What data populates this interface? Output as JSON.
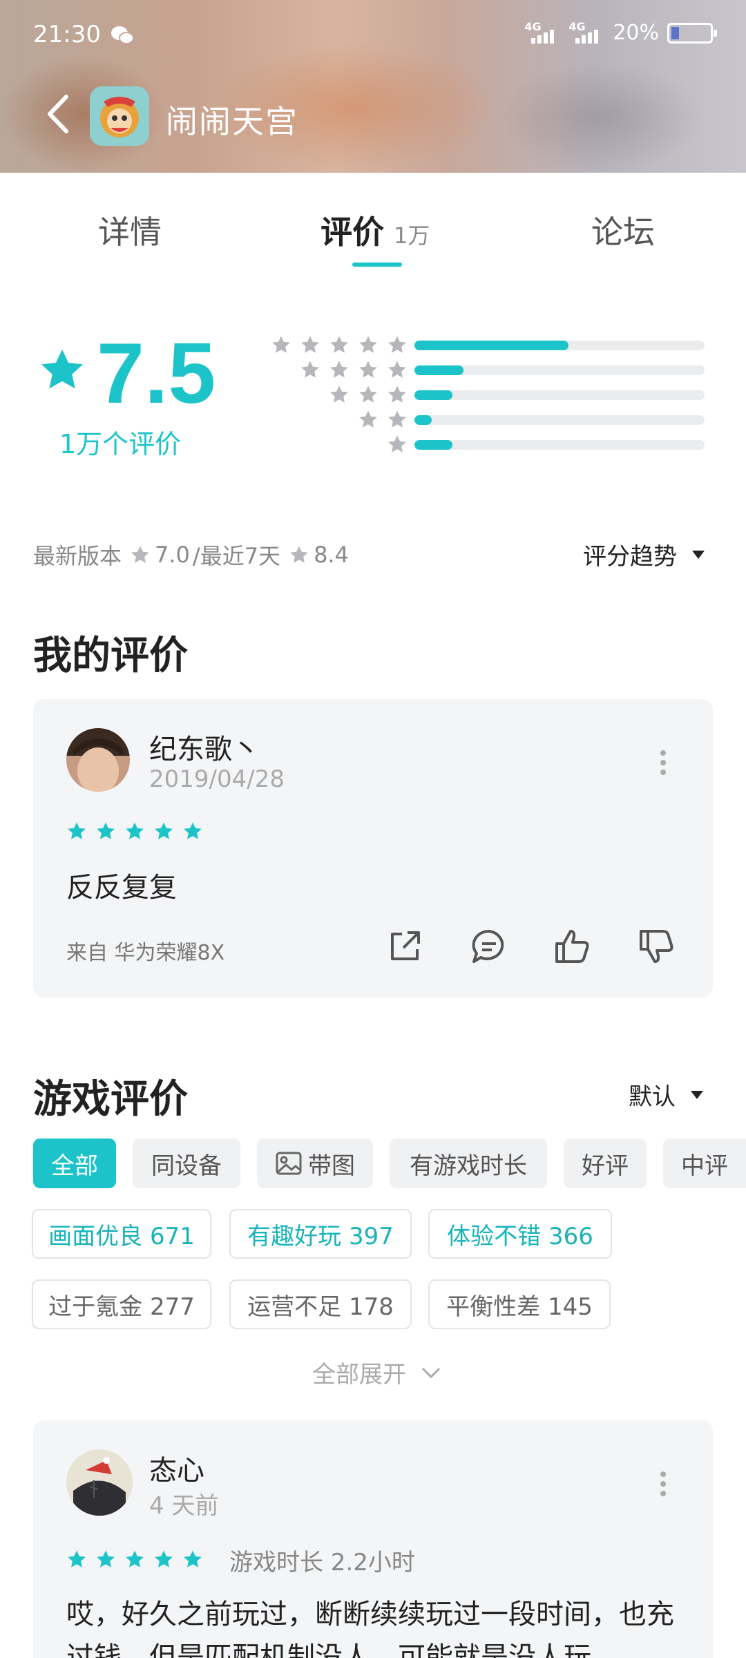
{
  "status_bar": {
    "time": "21:30",
    "signal1": "4G",
    "signal2": "4G",
    "battery": "20%",
    "battery_level": 0.2
  },
  "header": {
    "title": "闹闹天宫"
  },
  "tabs": [
    {
      "label": "详情"
    },
    {
      "label": "评价",
      "count": "1万"
    },
    {
      "label": "论坛"
    }
  ],
  "rating": {
    "score": "7.5",
    "count_label": "1万个评价",
    "distribution": [
      {
        "stars": 5,
        "fraction": 0.53
      },
      {
        "stars": 4,
        "fraction": 0.17
      },
      {
        "stars": 3,
        "fraction": 0.13
      },
      {
        "stars": 2,
        "fraction": 0.06
      },
      {
        "stars": 1,
        "fraction": 0.13
      }
    ]
  },
  "version": {
    "latest_label": "最新版本",
    "latest_score": "7.0",
    "recent_label": "/最近7天",
    "recent_score": "8.4",
    "trend_label": "评分趋势"
  },
  "my_review": {
    "section_title": "我的评价",
    "user": "纪东歌丶",
    "date": "2019/04/28",
    "stars": 5,
    "text": "反反复复",
    "device": "来自 华为荣耀8X"
  },
  "game_reviews": {
    "section_title": "游戏评价",
    "sort_label": "默认",
    "filters": [
      "全部",
      "同设备",
      "带图",
      "有游戏时长",
      "好评",
      "中评"
    ],
    "tags_positive": [
      {
        "label": "画面优良 671"
      },
      {
        "label": "有趣好玩 397"
      },
      {
        "label": "体验不错 366"
      }
    ],
    "tags_negative": [
      {
        "label": "过于氪金 277"
      },
      {
        "label": "运营不足 178"
      },
      {
        "label": "平衡性差 145"
      }
    ],
    "expand_label": "全部展开"
  },
  "review": {
    "user": "态心",
    "time": "4 天前",
    "stars": 5,
    "playtime": "游戏时长 2.2小时",
    "text": "哎，好久之前玩过，断断续续玩过一段时间，也充过钱，但是匹配机制没人，可能就是没人玩"
  },
  "colors": {
    "accent": "#1cc4ca",
    "card_bg": "#f4f5f7"
  }
}
